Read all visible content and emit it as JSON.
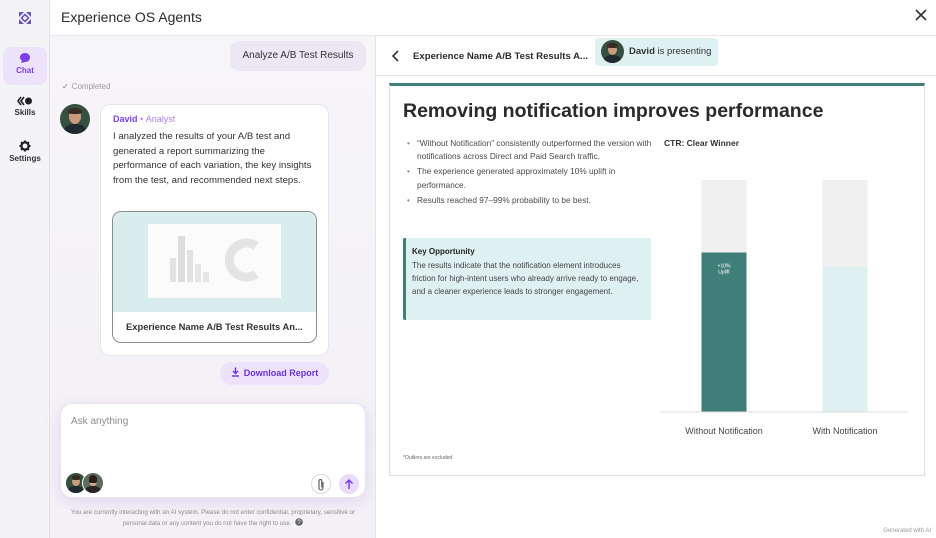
{
  "app": {
    "title": "Experience OS Agents"
  },
  "sidebar": {
    "items": [
      {
        "label": "Chat",
        "icon": "chat-bubble-icon",
        "active": true
      },
      {
        "label": "Skills",
        "icon": "skills-icon",
        "active": false
      },
      {
        "label": "Settings",
        "icon": "gear-icon",
        "active": false
      }
    ]
  },
  "chat": {
    "user_message": "Analyze A/B Test Results",
    "status": "Completed",
    "agent": {
      "name": "David",
      "separator": "•",
      "role": "Analyst",
      "message": "I analyzed the results of your A/B test and generated a report summarizing the performance of each variation, the key insights from the test, and recommended next steps."
    },
    "report_card": {
      "name": "Experience Name A/B Test Results An..."
    },
    "download_label": "Download Report",
    "input": {
      "placeholder": "Ask anything",
      "value": ""
    },
    "disclaimer": "You are currently interacting with an AI system. Please do not enter confidential, proprietary, sensitive or personal data or any content you do not have the right to use."
  },
  "viewer": {
    "title": "Experience Name A/B Test Results A...",
    "presenter_name": "David",
    "presenting_suffix": "is presenting",
    "slide": {
      "title": "Removing notification improves performance",
      "bullets": [
        "“Without Notification” consistently outperformed the version with notifications across Direct and Paid Search traffic.",
        "The experience generated approximately 10% uplift in performance.",
        "Results reached 97–99% probability to be best."
      ],
      "opportunity_heading": "Key Opportunity",
      "opportunity_text": "The results indicate that the notification element introduces friction for high-intent users who already arrive ready to engage, and a cleaner experience leads to stronger engagement.",
      "footnote": "*Outliers are excluded",
      "chart_heading": "CTR: Clear Winner"
    },
    "generated_label": "Generated with AI"
  },
  "colors": {
    "accent_purple": "#7b3fe4",
    "teal_dark": "#3f7f79",
    "teal_light": "#dff0f1",
    "bar_background": "#f0f0f1"
  },
  "chart_data": {
    "type": "bar",
    "title": "CTR: Clear Winner",
    "categories": [
      "Without Notification",
      "With Notification"
    ],
    "values": [
      1.1,
      1.0
    ],
    "ylim": [
      0,
      1.6
    ],
    "bar_label": "+10% Uplift",
    "grid": false,
    "legend": "none"
  }
}
